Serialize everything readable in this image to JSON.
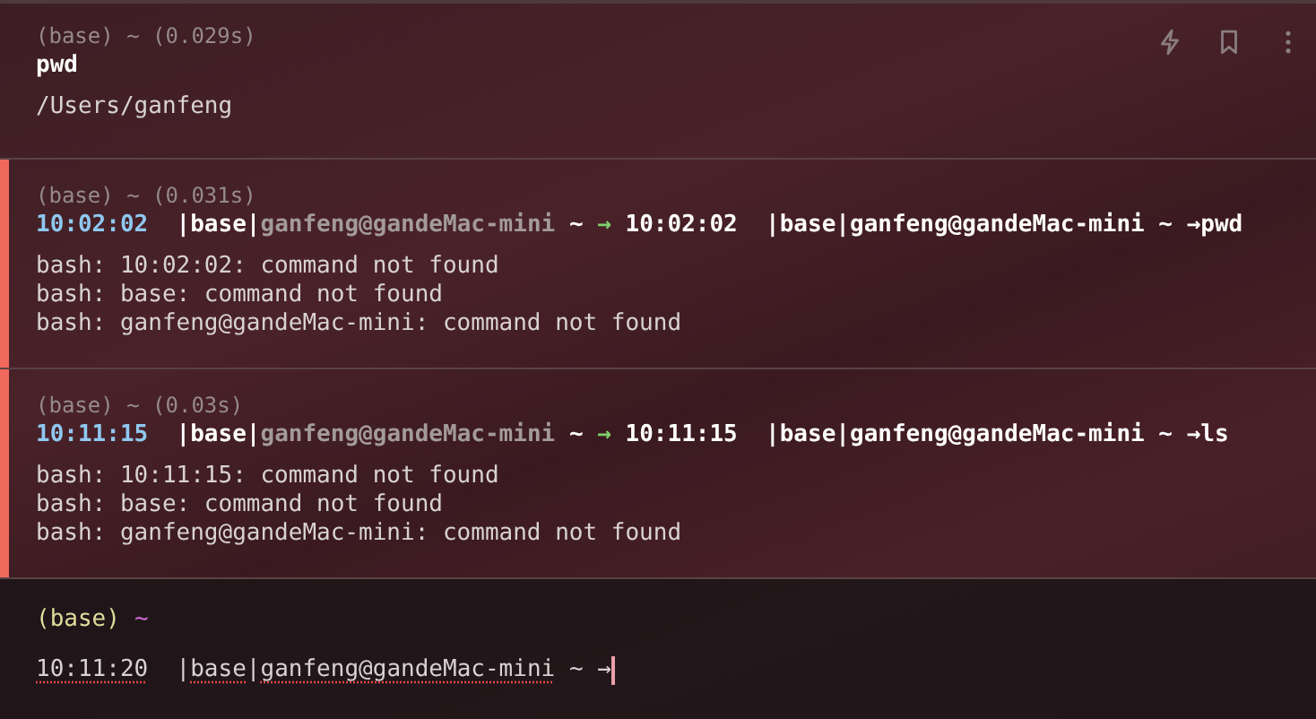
{
  "blocks": [
    {
      "header": "(base) ~ (0.029s)",
      "error": false,
      "command": [
        {
          "kind": "plain",
          "text": "pwd"
        }
      ],
      "output": [
        "/Users/ganfeng"
      ]
    },
    {
      "header": "(base) ~ (0.031s)",
      "error": true,
      "command": [
        {
          "kind": "time",
          "text": "10:02:02"
        },
        {
          "kind": "plain",
          "text": "  |base|"
        },
        {
          "kind": "host",
          "text": "ganfeng@gandeMac-mini"
        },
        {
          "kind": "plain",
          "text": " ~ "
        },
        {
          "kind": "arrow",
          "text": "→"
        },
        {
          "kind": "plain",
          "text": " 10:02:02  |base|ganfeng@gandeMac-mini ~ →pwd"
        }
      ],
      "output": [
        "bash: 10:02:02: command not found",
        "bash: base: command not found",
        "bash: ganfeng@gandeMac-mini: command not found"
      ]
    },
    {
      "header": "(base) ~ (0.03s)",
      "error": true,
      "command": [
        {
          "kind": "time",
          "text": "10:11:15"
        },
        {
          "kind": "plain",
          "text": "  |base|"
        },
        {
          "kind": "host",
          "text": "ganfeng@gandeMac-mini"
        },
        {
          "kind": "plain",
          "text": " ~ "
        },
        {
          "kind": "arrow",
          "text": "→"
        },
        {
          "kind": "plain",
          "text": " 10:11:15  |base|ganfeng@gandeMac-mini ~ →ls"
        }
      ],
      "output": [
        "bash: 10:11:15: command not found",
        "bash: base: command not found",
        "bash: ganfeng@gandeMac-mini: command not found"
      ]
    }
  ],
  "input": {
    "env": "(base)",
    "dir": "~",
    "segments": [
      {
        "text": "10:11:20",
        "flagged": true
      },
      {
        "text": "  |",
        "flagged": false
      },
      {
        "text": "base",
        "flagged": true
      },
      {
        "text": "|",
        "flagged": false
      },
      {
        "text": "ganfeng@gandeMac-mini",
        "flagged": true
      },
      {
        "text": " ~ →",
        "flagged": false
      }
    ]
  }
}
